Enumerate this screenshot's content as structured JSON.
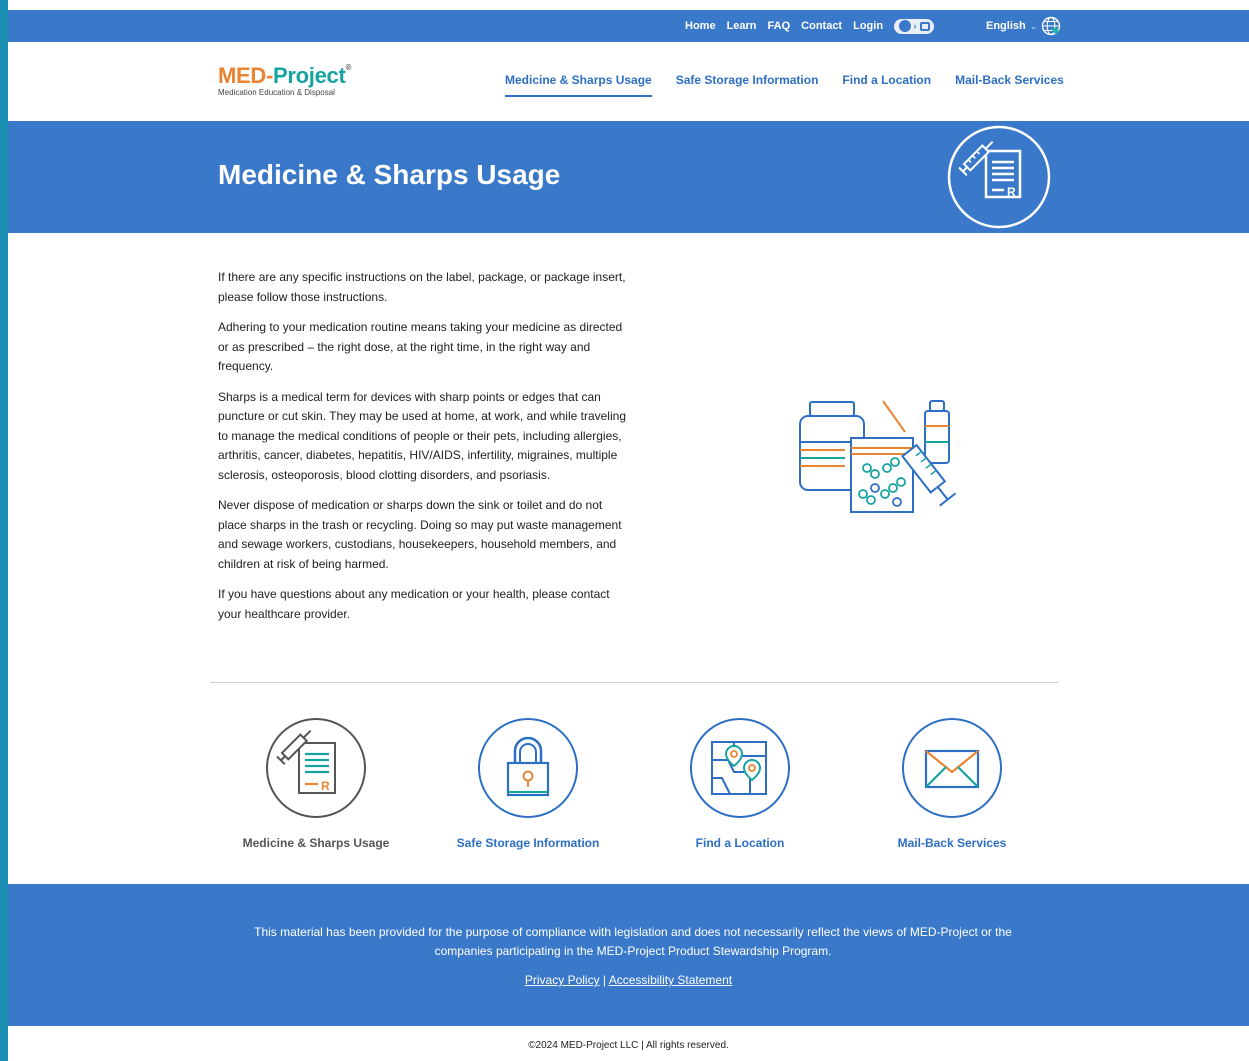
{
  "colors": {
    "primary_blue": "#3a78c9",
    "nav_blue": "#2d6fc4",
    "brand_orange": "#e98432",
    "brand_teal": "#17a3a0",
    "left_border": "#1a8fb3"
  },
  "topbar": {
    "links": [
      "Home",
      "Learn",
      "FAQ",
      "Contact",
      "Login"
    ],
    "accessibility_toggle_icon": "accessibility-toggle-icon",
    "language_label": "English",
    "language_icon": "globe-icon"
  },
  "header": {
    "logo_part1": "MED-",
    "logo_part2": "Project",
    "logo_reg": "®",
    "logo_subtitle": "Medication Education & Disposal",
    "nav": [
      {
        "label": "Medicine & Sharps Usage",
        "active": true
      },
      {
        "label": "Safe Storage Information",
        "active": false
      },
      {
        "label": "Find a Location",
        "active": false
      },
      {
        "label": "Mail-Back Services",
        "active": false
      }
    ]
  },
  "hero": {
    "title": "Medicine & Sharps Usage",
    "icon": "syringe-prescription-icon"
  },
  "main": {
    "paragraphs": [
      "If there are any specific instructions on the label, package, or package insert, please follow those instructions.",
      "Adhering to your medication routine means taking your medicine as directed or as prescribed – the right dose, at the right time, in the right way and frequency.",
      "Sharps is a medical term for devices with sharp points or edges that can puncture or cut skin. They may be used at home, at work, and while traveling to manage the medical conditions of people or their pets, including allergies, arthritis, cancer, diabetes, hepatitis, HIV/AIDS, infertility, migraines, multiple sclerosis, osteoporosis, blood clotting disorders, and psoriasis.",
      "Never dispose of medication or sharps down the sink or toilet and do not place sharps in the trash or recycling. Doing so may put waste management and sewage workers, custodians, housekeepers, household members, and children at risk of being harmed.",
      "If you have questions about any medication or your health, please contact your healthcare provider."
    ],
    "illustration": "medications-illustration"
  },
  "tiles": [
    {
      "label": "Medicine & Sharps Usage",
      "icon": "syringe-prescription-icon",
      "active": true
    },
    {
      "label": "Safe Storage Information",
      "icon": "lock-icon",
      "active": false
    },
    {
      "label": "Find a Location",
      "icon": "map-pin-icon",
      "active": false
    },
    {
      "label": "Mail-Back Services",
      "icon": "envelope-icon",
      "active": false
    }
  ],
  "footer": {
    "disclaimer": "This material has been provided for the purpose of compliance with legislation and does not necessarily reflect the views of MED-Project or the companies participating in the MED-Project Product Stewardship Program.",
    "privacy_link": "Privacy Policy",
    "separator": "|",
    "accessibility_link": "Accessibility Statement",
    "copyright": "©2024  MED-Project LLC | All rights reserved."
  }
}
